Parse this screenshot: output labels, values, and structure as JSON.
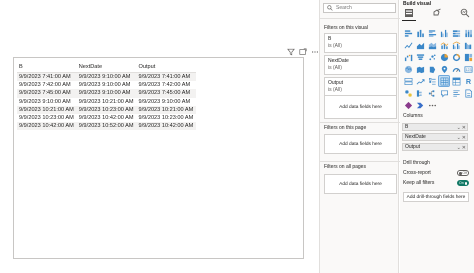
{
  "table": {
    "headers": [
      "B",
      "NextDate",
      "Output"
    ],
    "rows": [
      [
        "9/9/2023 7:41:00 AM",
        "9/9/2023 9:10:00 AM",
        "9/9/2023 7:41:00 AM"
      ],
      [
        "9/9/2023 7:42:00 AM",
        "9/9/2023 9:10:00 AM",
        "9/9/2023 7:42:00 AM"
      ],
      [
        "9/9/2023 7:45:00 AM",
        "9/9/2023 9:10:00 AM",
        "9/9/2023 7:45:00 AM"
      ],
      [
        "9/9/2023 9:10:00 AM",
        "9/9/2023 10:21:00 AM",
        "9/9/2023 9:10:00 AM"
      ],
      [
        "9/9/2023 10:21:00 AM",
        "9/9/2023 10:23:00 AM",
        "9/9/2023 10:21:00 AM"
      ],
      [
        "9/9/2023 10:23:00 AM",
        "9/9/2023 10:42:00 AM",
        "9/9/2023 10:23:00 AM"
      ],
      [
        "9/9/2023 10:42:00 AM",
        "9/9/2023 10:52:00 AM",
        "9/9/2023 10:42:00 AM"
      ]
    ]
  },
  "filters": {
    "search_placeholder": "Search",
    "on_visual_title": "Filters on this visual",
    "visual_filters": [
      {
        "name": "B",
        "value": "is (All)"
      },
      {
        "name": "NextDate",
        "value": "is (All)"
      },
      {
        "name": "Output",
        "value": "is (All)"
      }
    ],
    "add_fields": "Add data fields here",
    "on_page_title": "Filters on this page",
    "all_pages_title": "Filters on all pages"
  },
  "build": {
    "title": "Build visual",
    "columns_label": "Columns",
    "columns": [
      "B",
      "NextDate",
      "Output"
    ],
    "drill_title": "Drill through",
    "cross_report": {
      "label": "Cross-report",
      "state": "Off"
    },
    "keep_filters": {
      "label": "Keep all filters",
      "state": "On"
    },
    "add_drill": "Add drill-through fields here"
  },
  "colors": {
    "accent": "#117865",
    "selection": "#c7e0f4",
    "pane_bg": "#faf9f8"
  }
}
